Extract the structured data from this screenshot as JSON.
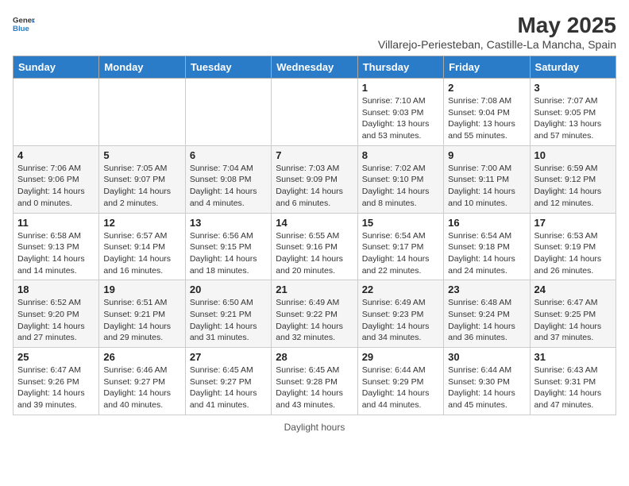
{
  "header": {
    "logo_line1": "General",
    "logo_line2": "Blue",
    "main_title": "May 2025",
    "subtitle": "Villarejo-Periesteban, Castille-La Mancha, Spain"
  },
  "columns": [
    "Sunday",
    "Monday",
    "Tuesday",
    "Wednesday",
    "Thursday",
    "Friday",
    "Saturday"
  ],
  "footer": {
    "daylight_label": "Daylight hours"
  },
  "weeks": [
    [
      {
        "day": "",
        "info": ""
      },
      {
        "day": "",
        "info": ""
      },
      {
        "day": "",
        "info": ""
      },
      {
        "day": "",
        "info": ""
      },
      {
        "day": "1",
        "info": "Sunrise: 7:10 AM\nSunset: 9:03 PM\nDaylight: 13 hours\nand 53 minutes."
      },
      {
        "day": "2",
        "info": "Sunrise: 7:08 AM\nSunset: 9:04 PM\nDaylight: 13 hours\nand 55 minutes."
      },
      {
        "day": "3",
        "info": "Sunrise: 7:07 AM\nSunset: 9:05 PM\nDaylight: 13 hours\nand 57 minutes."
      }
    ],
    [
      {
        "day": "4",
        "info": "Sunrise: 7:06 AM\nSunset: 9:06 PM\nDaylight: 14 hours\nand 0 minutes."
      },
      {
        "day": "5",
        "info": "Sunrise: 7:05 AM\nSunset: 9:07 PM\nDaylight: 14 hours\nand 2 minutes."
      },
      {
        "day": "6",
        "info": "Sunrise: 7:04 AM\nSunset: 9:08 PM\nDaylight: 14 hours\nand 4 minutes."
      },
      {
        "day": "7",
        "info": "Sunrise: 7:03 AM\nSunset: 9:09 PM\nDaylight: 14 hours\nand 6 minutes."
      },
      {
        "day": "8",
        "info": "Sunrise: 7:02 AM\nSunset: 9:10 PM\nDaylight: 14 hours\nand 8 minutes."
      },
      {
        "day": "9",
        "info": "Sunrise: 7:00 AM\nSunset: 9:11 PM\nDaylight: 14 hours\nand 10 minutes."
      },
      {
        "day": "10",
        "info": "Sunrise: 6:59 AM\nSunset: 9:12 PM\nDaylight: 14 hours\nand 12 minutes."
      }
    ],
    [
      {
        "day": "11",
        "info": "Sunrise: 6:58 AM\nSunset: 9:13 PM\nDaylight: 14 hours\nand 14 minutes."
      },
      {
        "day": "12",
        "info": "Sunrise: 6:57 AM\nSunset: 9:14 PM\nDaylight: 14 hours\nand 16 minutes."
      },
      {
        "day": "13",
        "info": "Sunrise: 6:56 AM\nSunset: 9:15 PM\nDaylight: 14 hours\nand 18 minutes."
      },
      {
        "day": "14",
        "info": "Sunrise: 6:55 AM\nSunset: 9:16 PM\nDaylight: 14 hours\nand 20 minutes."
      },
      {
        "day": "15",
        "info": "Sunrise: 6:54 AM\nSunset: 9:17 PM\nDaylight: 14 hours\nand 22 minutes."
      },
      {
        "day": "16",
        "info": "Sunrise: 6:54 AM\nSunset: 9:18 PM\nDaylight: 14 hours\nand 24 minutes."
      },
      {
        "day": "17",
        "info": "Sunrise: 6:53 AM\nSunset: 9:19 PM\nDaylight: 14 hours\nand 26 minutes."
      }
    ],
    [
      {
        "day": "18",
        "info": "Sunrise: 6:52 AM\nSunset: 9:20 PM\nDaylight: 14 hours\nand 27 minutes."
      },
      {
        "day": "19",
        "info": "Sunrise: 6:51 AM\nSunset: 9:21 PM\nDaylight: 14 hours\nand 29 minutes."
      },
      {
        "day": "20",
        "info": "Sunrise: 6:50 AM\nSunset: 9:21 PM\nDaylight: 14 hours\nand 31 minutes."
      },
      {
        "day": "21",
        "info": "Sunrise: 6:49 AM\nSunset: 9:22 PM\nDaylight: 14 hours\nand 32 minutes."
      },
      {
        "day": "22",
        "info": "Sunrise: 6:49 AM\nSunset: 9:23 PM\nDaylight: 14 hours\nand 34 minutes."
      },
      {
        "day": "23",
        "info": "Sunrise: 6:48 AM\nSunset: 9:24 PM\nDaylight: 14 hours\nand 36 minutes."
      },
      {
        "day": "24",
        "info": "Sunrise: 6:47 AM\nSunset: 9:25 PM\nDaylight: 14 hours\nand 37 minutes."
      }
    ],
    [
      {
        "day": "25",
        "info": "Sunrise: 6:47 AM\nSunset: 9:26 PM\nDaylight: 14 hours\nand 39 minutes."
      },
      {
        "day": "26",
        "info": "Sunrise: 6:46 AM\nSunset: 9:27 PM\nDaylight: 14 hours\nand 40 minutes."
      },
      {
        "day": "27",
        "info": "Sunrise: 6:45 AM\nSunset: 9:27 PM\nDaylight: 14 hours\nand 41 minutes."
      },
      {
        "day": "28",
        "info": "Sunrise: 6:45 AM\nSunset: 9:28 PM\nDaylight: 14 hours\nand 43 minutes."
      },
      {
        "day": "29",
        "info": "Sunrise: 6:44 AM\nSunset: 9:29 PM\nDaylight: 14 hours\nand 44 minutes."
      },
      {
        "day": "30",
        "info": "Sunrise: 6:44 AM\nSunset: 9:30 PM\nDaylight: 14 hours\nand 45 minutes."
      },
      {
        "day": "31",
        "info": "Sunrise: 6:43 AM\nSunset: 9:31 PM\nDaylight: 14 hours\nand 47 minutes."
      }
    ]
  ]
}
